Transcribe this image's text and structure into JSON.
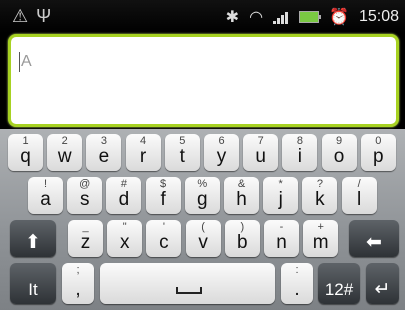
{
  "status": {
    "time": "15:08",
    "icons": [
      "warning-icon",
      "usb-icon",
      "bluetooth-icon",
      "wifi-icon",
      "signal-icon",
      "battery-icon",
      "alarm-icon"
    ]
  },
  "editor": {
    "value": "A"
  },
  "keyboard": {
    "row1": [
      {
        "p": "q",
        "s": "1"
      },
      {
        "p": "w",
        "s": "2"
      },
      {
        "p": "e",
        "s": "3"
      },
      {
        "p": "r",
        "s": "4"
      },
      {
        "p": "t",
        "s": "5"
      },
      {
        "p": "y",
        "s": "6"
      },
      {
        "p": "u",
        "s": "7"
      },
      {
        "p": "i",
        "s": "8"
      },
      {
        "p": "o",
        "s": "9"
      },
      {
        "p": "p",
        "s": "0"
      }
    ],
    "row2": [
      {
        "p": "a",
        "s": "!"
      },
      {
        "p": "s",
        "s": "@"
      },
      {
        "p": "d",
        "s": "#"
      },
      {
        "p": "f",
        "s": "$"
      },
      {
        "p": "g",
        "s": "%"
      },
      {
        "p": "h",
        "s": "&"
      },
      {
        "p": "j",
        "s": "*"
      },
      {
        "p": "k",
        "s": "?"
      },
      {
        "p": "l",
        "s": "/"
      }
    ],
    "row3": [
      {
        "p": "z",
        "s": "_"
      },
      {
        "p": "x",
        "s": "\""
      },
      {
        "p": "c",
        "s": "'"
      },
      {
        "p": "v",
        "s": "("
      },
      {
        "p": "b",
        "s": ")"
      },
      {
        "p": "n",
        "s": "-"
      },
      {
        "p": "m",
        "s": "+"
      }
    ],
    "row4": {
      "lang_label": "It",
      "punct_primary": ";",
      "punct_secondary": ",",
      "space_label": "",
      "period_primary": ".",
      "period_secondary": ":",
      "symbols_label": "12#"
    },
    "shift_label": "⬆",
    "backspace_label": "⬅",
    "enter_label": "↵"
  }
}
